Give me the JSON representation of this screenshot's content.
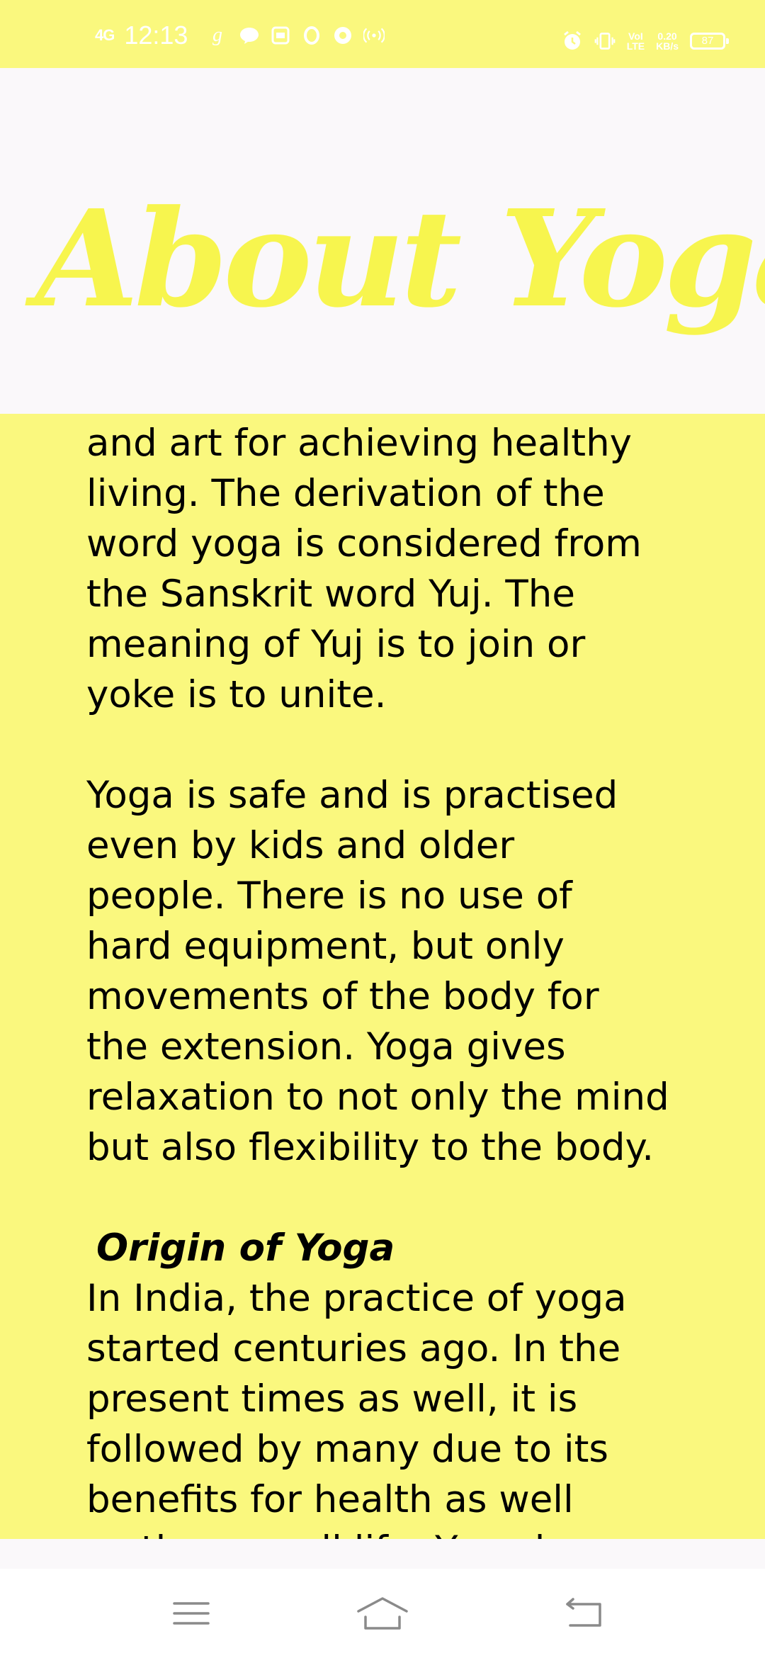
{
  "status_bar": {
    "network": "4G",
    "time": "12:13",
    "speed_value": "0.20",
    "speed_unit": "KB/s",
    "volte_top": "VoI",
    "volte_bottom": "LTE",
    "battery": "87",
    "icons_left": [
      "g-app-icon",
      "chat-bubble-icon",
      "calendar-icon",
      "opera-icon",
      "record-icon",
      "hotspot-icon"
    ],
    "icons_right": [
      "alarm-icon",
      "vibrate-icon"
    ]
  },
  "header": {
    "title": "About Yoga"
  },
  "content": {
    "paragraph1": [
      "and art for achieving healthy",
      "living. The derivation of the",
      "word yoga is considered from",
      "the Sanskrit word Yuj. The",
      "meaning of Yuj is to join or",
      "yoke is to unite."
    ],
    "paragraph2": [
      "Yoga is safe and is practised",
      "even by kids and older",
      "people. There is no use of",
      "hard equipment, but only",
      "movements of the body for",
      "the extension. Yoga gives",
      "relaxation to not only the mind",
      "but also flexibility to the body."
    ],
    "section_heading": "Origin of Yoga",
    "paragraph3": [
      "In India, the practice of yoga",
      "started centuries ago. In the",
      "present times as well, it is",
      "followed by many due to its",
      "benefits for health as well",
      "as the overall life. Yoga has"
    ]
  },
  "nav_bar": {
    "buttons": [
      "menu-icon",
      "home-icon",
      "back-icon"
    ]
  },
  "colors": {
    "accent_yellow": "#faf87e",
    "title_yellow": "#f7f54e",
    "header_bg": "#faf8fa"
  }
}
